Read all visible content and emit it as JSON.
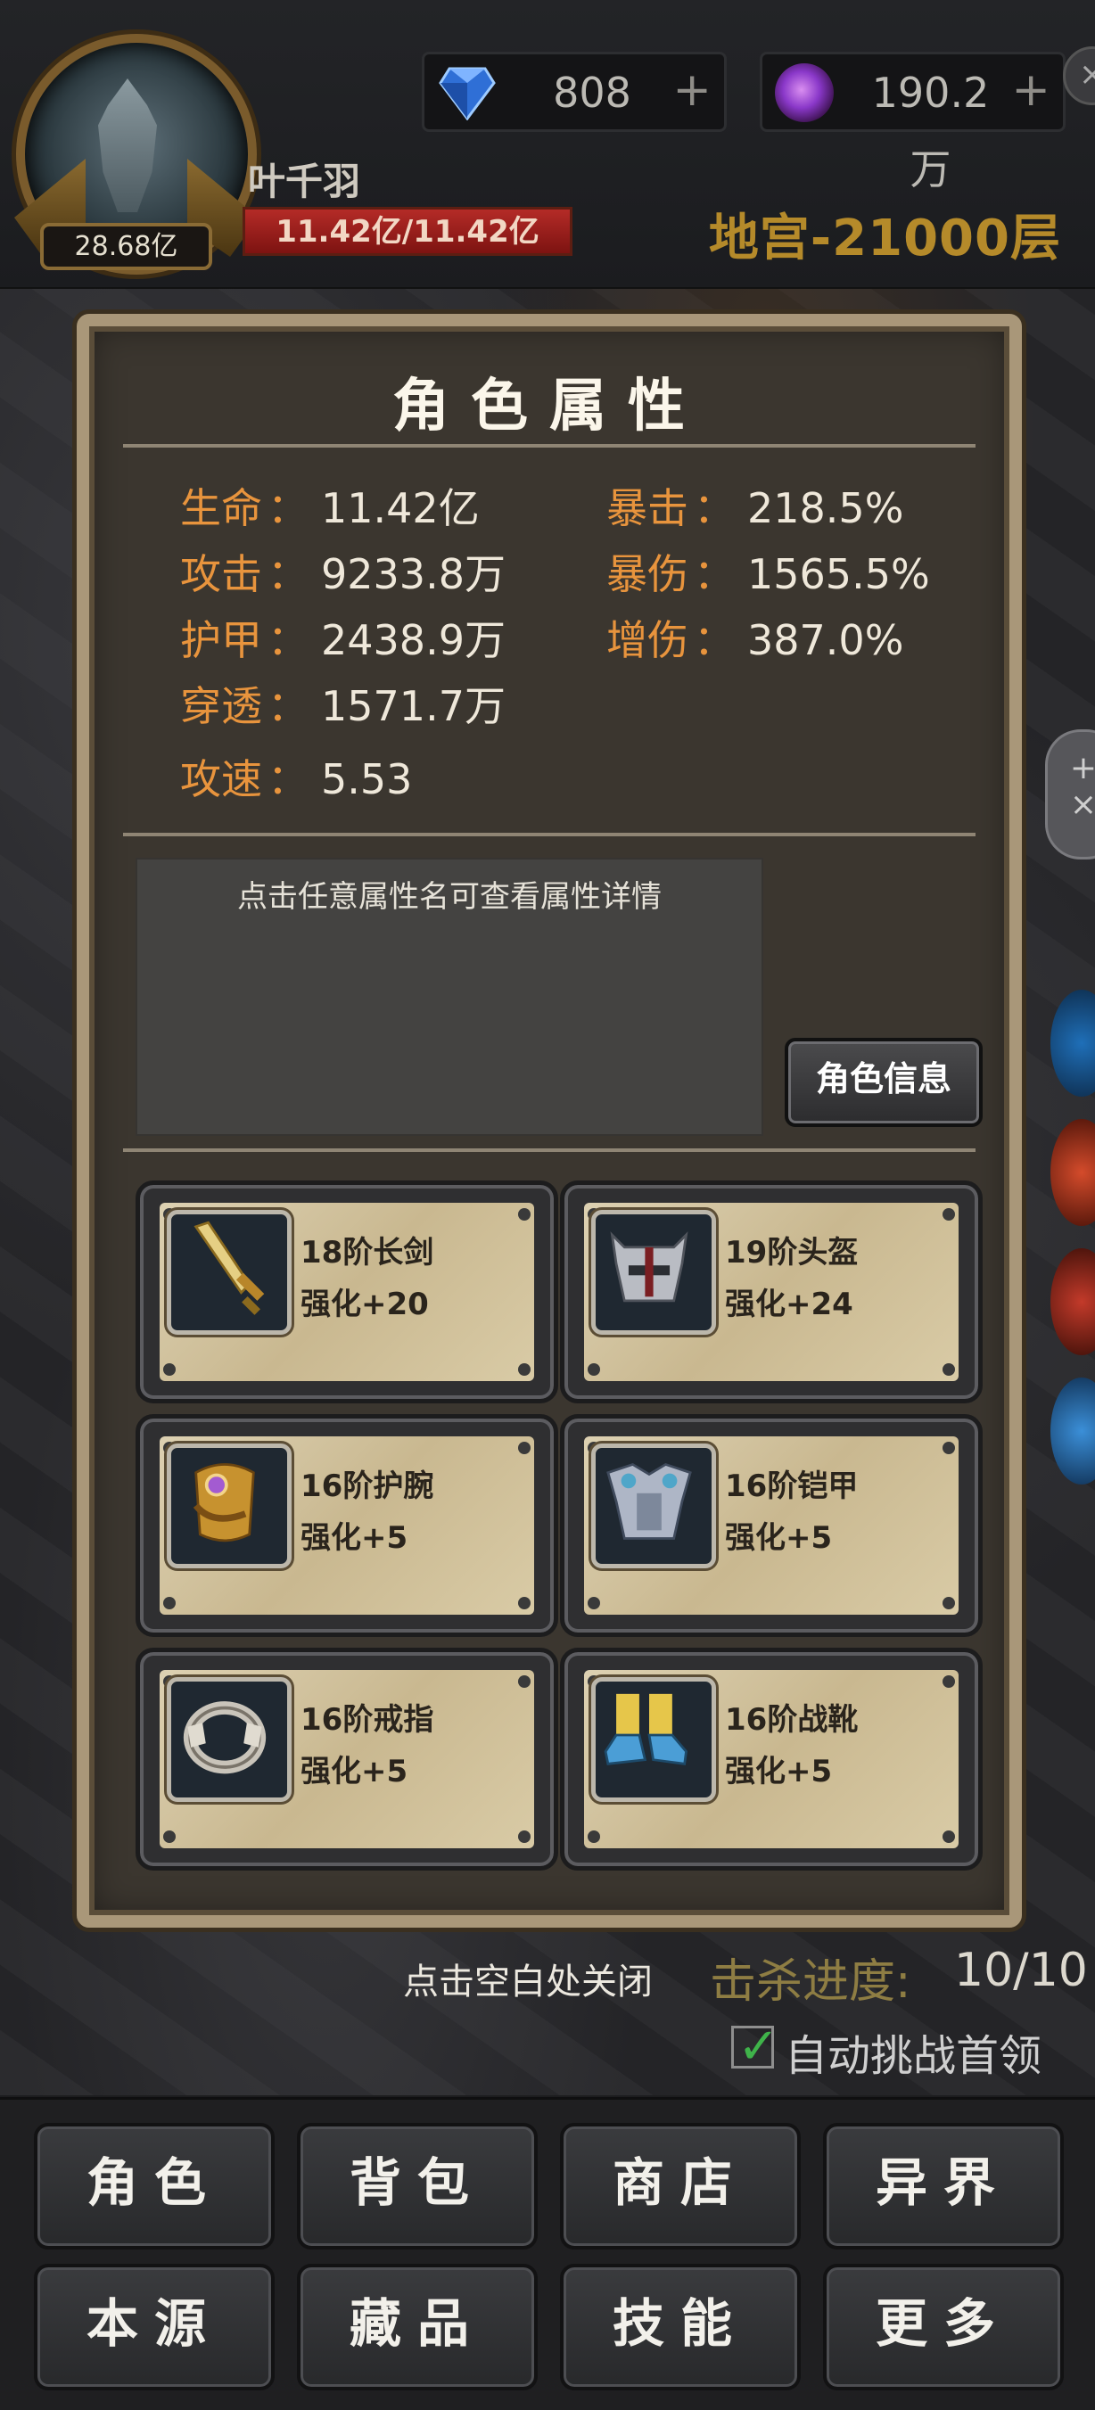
{
  "header": {
    "player_name": "叶千羽",
    "power": "28.68亿",
    "hp": "11.42亿/11.42亿",
    "gems": "808",
    "essence": "190.2万",
    "plus": "+",
    "floor": "地宫-21000层",
    "close": "×"
  },
  "panel": {
    "title": "角色属性",
    "colon": "：",
    "stats_left": [
      {
        "name": "生命",
        "value": "11.42亿"
      },
      {
        "name": "攻击",
        "value": "9233.8万"
      },
      {
        "name": "护甲",
        "value": "2438.9万"
      },
      {
        "name": "穿透",
        "value": "1571.7万"
      },
      {
        "name": "攻速",
        "value": "5.53"
      }
    ],
    "stats_right": [
      {
        "name": "暴击",
        "value": "218.5%"
      },
      {
        "name": "暴伤",
        "value": "1565.5%"
      },
      {
        "name": "增伤",
        "value": "387.0%"
      }
    ],
    "hint": "点击任意属性名可查看属性详情",
    "char_info_button": "角色信息",
    "equipment": [
      {
        "name": "18阶长剑",
        "level": "强化+20",
        "icon": "sword-icon"
      },
      {
        "name": "19阶头盔",
        "level": "强化+24",
        "icon": "helmet-icon"
      },
      {
        "name": "16阶护腕",
        "level": "强化+5",
        "icon": "bracer-icon"
      },
      {
        "name": "16阶铠甲",
        "level": "强化+5",
        "icon": "armor-icon"
      },
      {
        "name": "16阶戒指",
        "level": "强化+5",
        "icon": "ring-icon"
      },
      {
        "name": "16阶战靴",
        "level": "强化+5",
        "icon": "boots-icon"
      }
    ]
  },
  "footer": {
    "close_hint": "点击空白处关闭",
    "kill_label": "击杀进度:",
    "kill_value": "10/10",
    "auto_label": "自动挑战首领",
    "auto_checked": true,
    "menu": [
      "角色",
      "背包",
      "商店",
      "异界",
      "本源",
      "藏品",
      "技能",
      "更多"
    ]
  },
  "colors": {
    "accent_orange": "#e8943d",
    "floor_gold": "#b58a2a",
    "hp_red": "#b42b27",
    "check_green": "#3fb34a"
  }
}
